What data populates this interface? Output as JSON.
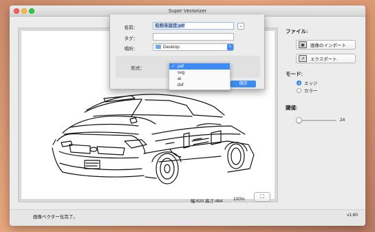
{
  "window": {
    "title": "Super Vectorizer"
  },
  "save_sheet": {
    "name_label": "名前：",
    "filename_value": "名称未設定.pdf",
    "tags_label": "タグ：",
    "tags_value": "",
    "location_label": "場所：",
    "location_value": "Desktop",
    "format_label": "形式：",
    "format_options": [
      "pdf",
      "svg",
      "ai",
      "dxf"
    ],
    "selected_format": "pdf",
    "save_label": "保存",
    "expand_icon": "chevron-down-icon"
  },
  "canvas": {
    "image_info": "幅:620 高さ:464",
    "zoom": "100%",
    "fit_icon": "fit-to-window-icon"
  },
  "sidebar": {
    "file_heading": "ファイル:",
    "import_label": "画像のインポート",
    "export_label": "エクスポート",
    "mode_heading": "モード:",
    "mode_options": [
      "エッジ",
      "カラー"
    ],
    "selected_mode": "エッジ",
    "threshold_heading": "閾値:",
    "threshold_value": "24",
    "threshold_fraction": 0.06
  },
  "status_bar": {
    "status_text": "画像ベクター化完了。",
    "version": "v1.60"
  },
  "colors": {
    "accent": "#3d8bf5",
    "desktop_bg": "#d9946f"
  }
}
